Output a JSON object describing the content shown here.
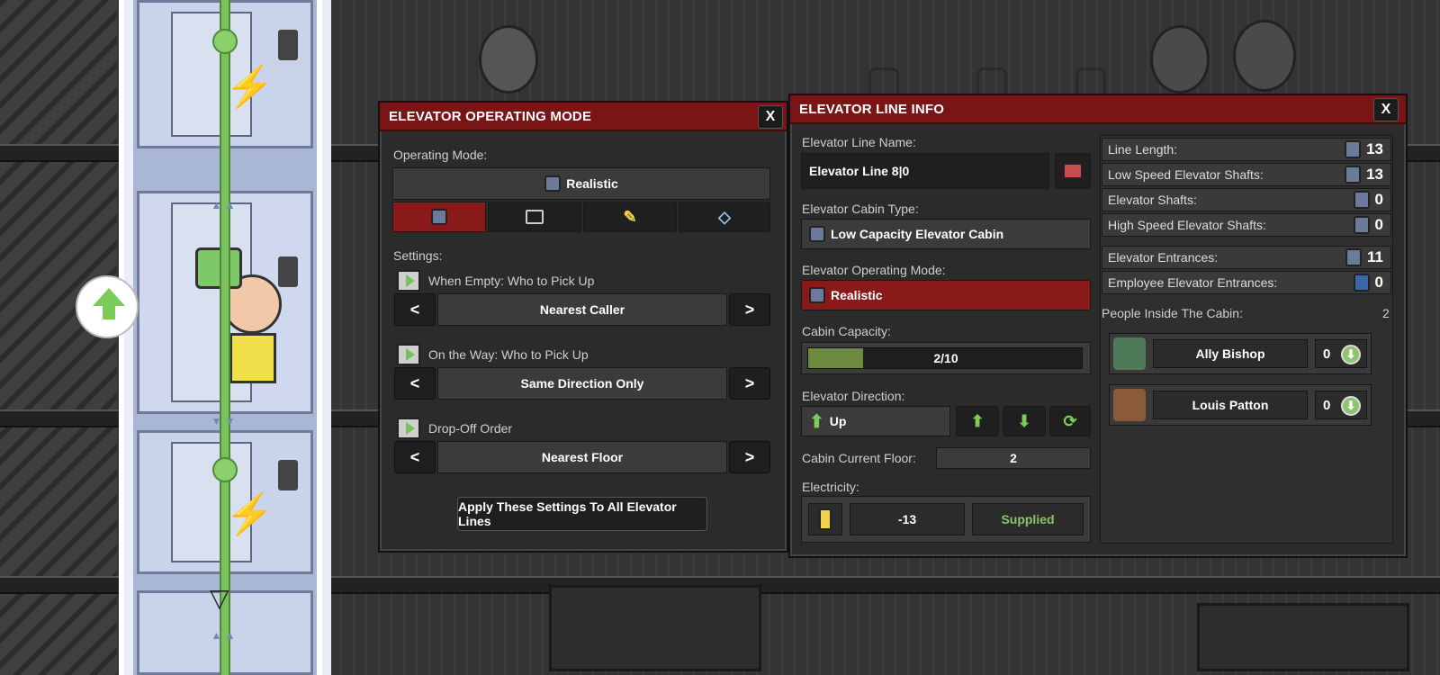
{
  "colors": {
    "accent_red": "#7a1516",
    "selected_red": "#8a1a1a",
    "green": "#7cc15f",
    "panel_bg": "#2b2b2b"
  },
  "scene": {
    "up_button_icon": "up-arrow-icon"
  },
  "operating_mode_panel": {
    "title": "ELEVATOR OPERATING MODE",
    "close_label": "X",
    "operating_mode_label": "Operating Mode:",
    "current_mode": "Realistic",
    "mode_buttons": [
      {
        "icon": "realistic-mode-icon",
        "selected": true
      },
      {
        "icon": "server-mode-icon",
        "selected": false
      },
      {
        "icon": "cleaning-mode-icon",
        "selected": false
      },
      {
        "icon": "diamond-mode-icon",
        "selected": false
      }
    ],
    "settings_label": "Settings:",
    "settings": [
      {
        "label": "When Empty: Who to Pick Up",
        "value": "Nearest Caller"
      },
      {
        "label": "On the Way: Who to Pick Up",
        "value": "Same Direction Only"
      },
      {
        "label": "Drop-Off Order",
        "value": "Nearest Floor"
      }
    ],
    "prev_label": "<",
    "next_label": ">",
    "apply_button": "Apply These Settings To All Elevator Lines"
  },
  "line_info_panel": {
    "title": "ELEVATOR LINE INFO",
    "close_label": "X",
    "line_name_label": "Elevator Line Name:",
    "line_name_value": "Elevator Line 8|0",
    "cabin_type_label": "Elevator Cabin Type:",
    "cabin_type_value": "Low Capacity Elevator Cabin",
    "operating_mode_label": "Elevator Operating Mode:",
    "operating_mode_value": "Realistic",
    "cabin_capacity_label": "Cabin Capacity:",
    "cabin_capacity_text": "2/10",
    "cabin_capacity_fraction": 0.2,
    "direction_label": "Elevator Direction:",
    "direction_value": "Up",
    "current_floor_label": "Cabin Current Floor:",
    "current_floor_value": "2",
    "electricity_label": "Electricity:",
    "electricity_value": "-13",
    "electricity_status": "Supplied",
    "stats": [
      {
        "label": "Line Length:",
        "value": "13"
      },
      {
        "label": "Low Speed Elevator Shafts:",
        "value": "13"
      },
      {
        "label": "Elevator Shafts:",
        "value": "0"
      },
      {
        "label": "High Speed Elevator Shafts:",
        "value": "0"
      }
    ],
    "entrances": [
      {
        "label": "Elevator Entrances:",
        "value": "11"
      },
      {
        "label": "Employee Elevator Entrances:",
        "value": "0"
      }
    ],
    "people_label": "People Inside The Cabin:",
    "people_count": "2",
    "people": [
      {
        "name": "Ally Bishop",
        "count": "0"
      },
      {
        "name": "Louis Patton",
        "count": "0"
      }
    ]
  }
}
